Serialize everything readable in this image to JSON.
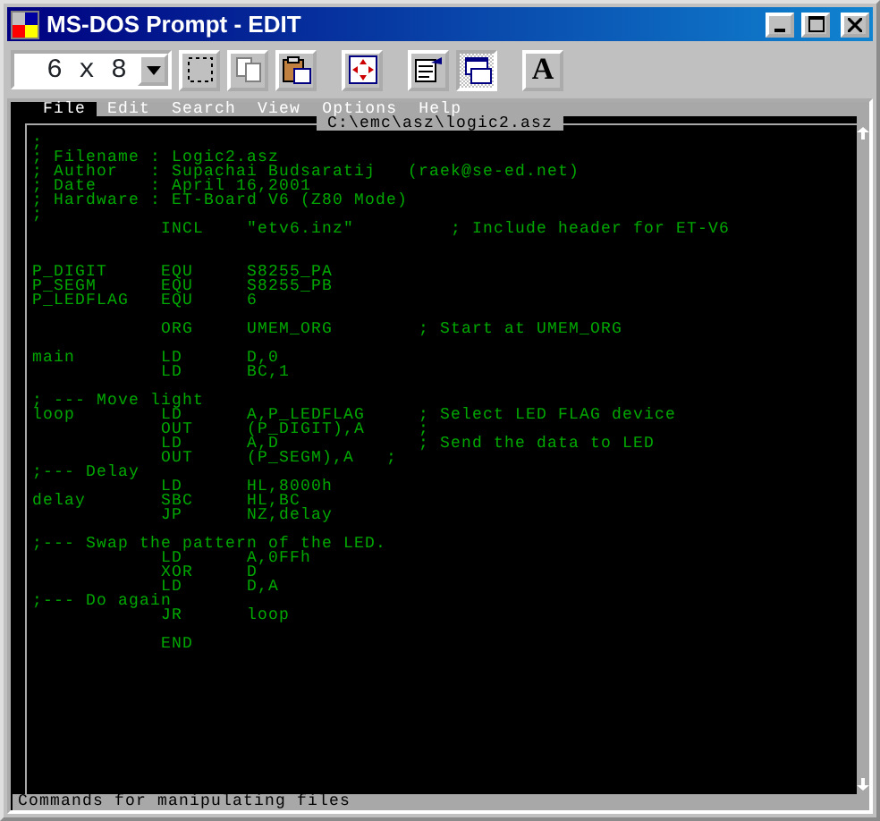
{
  "window": {
    "title": "MS-DOS Prompt - EDIT"
  },
  "toolbar": {
    "font_size": "6 x 8",
    "buttons": [
      {
        "kind": "mark",
        "pressed": false
      },
      {
        "kind": "copy",
        "pressed": false
      },
      {
        "kind": "paste",
        "pressed": false
      },
      {
        "kind": "fullscreen",
        "pressed": false
      },
      {
        "kind": "properties",
        "pressed": false
      },
      {
        "kind": "background",
        "pressed": true
      },
      {
        "kind": "font",
        "label": "A",
        "pressed": false
      }
    ]
  },
  "menu": [
    {
      "label": "File",
      "selected": true
    },
    {
      "label": "Edit",
      "selected": false
    },
    {
      "label": "Search",
      "selected": false
    },
    {
      "label": "View",
      "selected": false
    },
    {
      "label": "Options",
      "selected": false
    },
    {
      "label": "Help",
      "selected": false
    }
  ],
  "editor": {
    "file_path": "C:\\emc\\asz\\logic2.asz",
    "lines": [
      {
        "kind": "code",
        "text": ";"
      },
      {
        "kind": "code",
        "text": "; Filename : Logic2.asz"
      },
      {
        "kind": "code",
        "text": "; Author   : Supachai Budsaratij   (raek@se-ed.net)"
      },
      {
        "kind": "code",
        "text": "; Date     : April 16,2001"
      },
      {
        "kind": "code",
        "text": "; Hardware : ET-Board V6 (Z80 Mode)"
      },
      {
        "kind": "code",
        "text": ";"
      },
      {
        "kind": "code",
        "text": "            INCL    \"etv6.inz\"         ; Include header for ET-V6"
      },
      {
        "kind": "blank"
      },
      {
        "kind": "blank"
      },
      {
        "kind": "code",
        "text": "P_DIGIT     EQU     S8255_PA"
      },
      {
        "kind": "code",
        "text": "P_SEGM      EQU     S8255_PB"
      },
      {
        "kind": "code",
        "text": "P_LEDFLAG   EQU     6"
      },
      {
        "kind": "blank"
      },
      {
        "kind": "code",
        "text": "            ORG     UMEM_ORG        ; Start at UMEM_ORG"
      },
      {
        "kind": "blank"
      },
      {
        "kind": "code",
        "text": "main        LD      D,0"
      },
      {
        "kind": "code",
        "text": "            LD      BC,1"
      },
      {
        "kind": "blank"
      },
      {
        "kind": "code",
        "text": "; --- Move light"
      },
      {
        "kind": "code",
        "text": "loop        LD      A,P_LEDFLAG     ; Select LED FLAG device"
      },
      {
        "kind": "code",
        "text": "            OUT     (P_DIGIT),A     ;"
      },
      {
        "kind": "code",
        "text": "            LD      A,D             ; Send the data to LED"
      },
      {
        "kind": "code",
        "text": "            OUT     (P_SEGM),A   ;"
      },
      {
        "kind": "code",
        "text": ";--- Delay"
      },
      {
        "kind": "code",
        "text": "            LD      HL,8000h"
      },
      {
        "kind": "code",
        "text": "delay       SBC     HL,BC"
      },
      {
        "kind": "code",
        "text": "            JP      NZ,delay"
      },
      {
        "kind": "blank"
      },
      {
        "kind": "code",
        "text": ";--- Swap the pattern of the LED."
      },
      {
        "kind": "code",
        "text": "            LD      A,0FFh"
      },
      {
        "kind": "code",
        "text": "            XOR     D"
      },
      {
        "kind": "code",
        "text": "            LD      D,A"
      },
      {
        "kind": "code",
        "text": ";--- Do again"
      },
      {
        "kind": "code",
        "text": "            JR      loop"
      },
      {
        "kind": "blank"
      },
      {
        "kind": "code",
        "text": "            END"
      }
    ]
  },
  "status_bar": {
    "text": "Commands for manipulating files"
  }
}
